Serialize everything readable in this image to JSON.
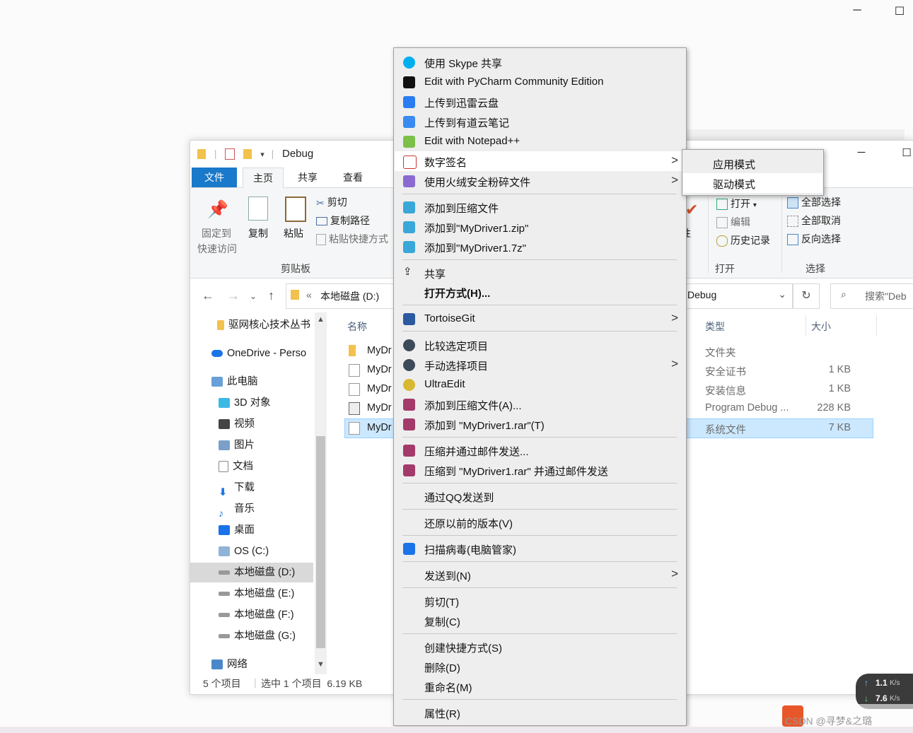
{
  "explorer": {
    "title": "Debug",
    "tabs": [
      "文件",
      "主页",
      "共享",
      "查看"
    ],
    "ribbon": {
      "pin_label_1": "固定到",
      "pin_label_2": "快速访问",
      "copy": "复制",
      "paste": "粘贴",
      "cut": "剪切",
      "copy_path": "复制路径",
      "paste_shortcut": "粘贴快捷方式",
      "clipboard_group": "剪贴板",
      "properties": "属性",
      "open": "打开",
      "edit": "编辑",
      "history": "历史记录",
      "open_group": "打开",
      "select_all": "全部选择",
      "select_none": "全部取消",
      "invert_selection": "反向选择",
      "select_group": "选择"
    },
    "address": {
      "chevrons": "«",
      "drive": "本地磁盘 (D:)",
      "current": "Debug",
      "search_placeholder": "搜索\"Deb"
    },
    "nav": {
      "quick": "驱网核心技术丛书",
      "onedrive": "OneDrive - Perso",
      "this_pc": "此电脑",
      "objects3d": "3D 对象",
      "videos": "视频",
      "pictures": "图片",
      "documents": "文档",
      "downloads": "下载",
      "music": "音乐",
      "desktop": "桌面",
      "c": "OS (C:)",
      "d": "本地磁盘 (D:)",
      "e": "本地磁盘 (E:)",
      "f": "本地磁盘 (F:)",
      "g": "本地磁盘 (G:)",
      "network": "网络"
    },
    "columns": {
      "name": "名称",
      "type": "类型",
      "size": "大小"
    },
    "files": [
      {
        "name": "MyDr",
        "type": "文件夹",
        "size": ""
      },
      {
        "name": "MyDr",
        "type": "安全证书",
        "size": "1 KB"
      },
      {
        "name": "MyDr",
        "type": "安装信息",
        "size": "1 KB"
      },
      {
        "name": "MyDr",
        "type": "Program Debug ...",
        "size": "228 KB"
      },
      {
        "name": "MyDr",
        "type": "系统文件",
        "size": "7 KB"
      }
    ],
    "status": {
      "count": "5 个项目",
      "selection": "选中 1 个项目  6.19 KB"
    }
  },
  "context_menu": {
    "items": [
      "使用 Skype 共享",
      "Edit with PyCharm Community Edition",
      "上传到迅雷云盘",
      "上传到有道云笔记",
      "Edit with Notepad++",
      "数字签名",
      "使用火绒安全粉碎文件",
      "添加到压缩文件",
      "添加到\"MyDriver1.zip\"",
      "添加到\"MyDriver1.7z\"",
      "共享",
      "打开方式(H)...",
      "TortoiseGit",
      "比较选定项目",
      "手动选择项目",
      "UltraEdit",
      "添加到压缩文件(A)...",
      "添加到 \"MyDriver1.rar\"(T)",
      "压缩并通过邮件发送...",
      "压缩到 \"MyDriver1.rar\" 并通过邮件发送",
      "通过QQ发送到",
      "还原以前的版本(V)",
      "扫描病毒(电脑管家)",
      "发送到(N)",
      "剪切(T)",
      "复制(C)",
      "创建快捷方式(S)",
      "删除(D)",
      "重命名(M)",
      "属性(R)"
    ],
    "submenu": [
      "应用模式",
      "驱动模式"
    ]
  },
  "tray": {
    "upload_speed": "1.1",
    "upload_unit": "K/s",
    "download_speed": "7.6",
    "download_unit": "K/s",
    "watermark": "CSDN @寻梦&之璐"
  },
  "colors": {
    "accent": "#1979ca",
    "selection": "#cce8ff",
    "menu_bg": "#eeeeee"
  }
}
